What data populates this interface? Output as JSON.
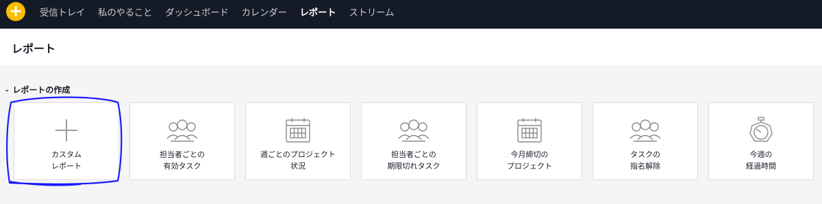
{
  "topbar": {
    "add_symbol": "+",
    "nav": [
      {
        "label": "受信トレイ"
      },
      {
        "label": "私のやること"
      },
      {
        "label": "ダッシュボード"
      },
      {
        "label": "カレンダー"
      },
      {
        "label": "レポート"
      },
      {
        "label": "ストリーム"
      }
    ]
  },
  "header": {
    "title": "レポート"
  },
  "section": {
    "label": "レポートの作成"
  },
  "cards": [
    {
      "icon": "plus-icon",
      "label": "カスタム\nレポート"
    },
    {
      "icon": "people-icon",
      "label": "担当者ごとの\n有効タスク"
    },
    {
      "icon": "calendar-icon",
      "label": "週ごとのプロジェクト\n状況"
    },
    {
      "icon": "people-icon",
      "label": "担当者ごとの\n期限切れタスク"
    },
    {
      "icon": "calendar-icon",
      "label": "今月締切の\nプロジェクト"
    },
    {
      "icon": "people-icon",
      "label": "タスクの\n指名解除"
    },
    {
      "icon": "stopwatch-icon",
      "label": "今週の\n経過時間"
    }
  ],
  "colors": {
    "topbar": "#151b26",
    "accent": "#fcbd01",
    "annotation": "#1a1aff"
  }
}
